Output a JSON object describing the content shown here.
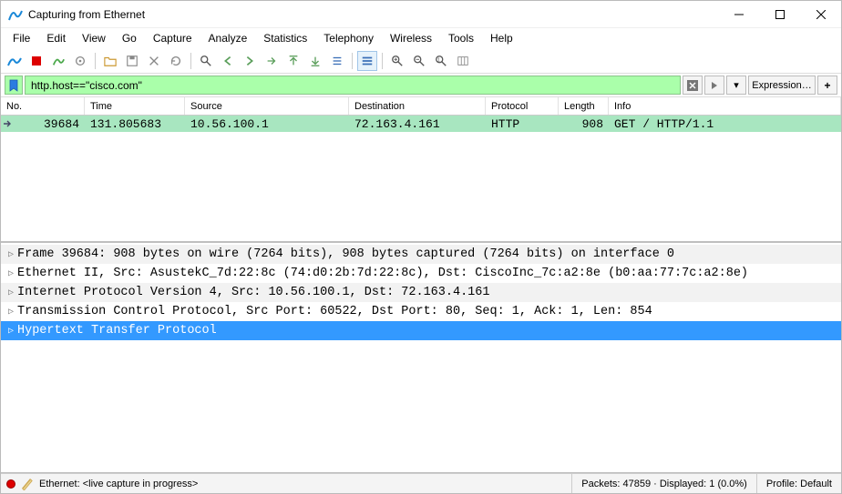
{
  "window": {
    "title": "Capturing from Ethernet"
  },
  "menu": {
    "items": [
      "File",
      "Edit",
      "View",
      "Go",
      "Capture",
      "Analyze",
      "Statistics",
      "Telephony",
      "Wireless",
      "Tools",
      "Help"
    ]
  },
  "filter": {
    "value": "http.host==\"cisco.com\"",
    "expression_label": "Expression…",
    "plus_label": "+"
  },
  "packet_list": {
    "columns": [
      "No.",
      "Time",
      "Source",
      "Destination",
      "Protocol",
      "Length",
      "Info"
    ],
    "rows": [
      {
        "no": "39684",
        "time": "131.805683",
        "source": "10.56.100.1",
        "destination": "72.163.4.161",
        "protocol": "HTTP",
        "length": "908",
        "info": "GET  /  HTTP/1.1"
      }
    ]
  },
  "packet_details": {
    "lines": [
      "Frame 39684: 908 bytes on wire (7264 bits), 908 bytes captured (7264 bits) on interface 0",
      "Ethernet II, Src: AsustekC_7d:22:8c (74:d0:2b:7d:22:8c), Dst: CiscoInc_7c:a2:8e (b0:aa:77:7c:a2:8e)",
      "Internet Protocol Version 4, Src: 10.56.100.1, Dst: 72.163.4.161",
      "Transmission Control Protocol, Src Port: 60522, Dst Port: 80, Seq: 1, Ack: 1, Len: 854",
      "Hypertext Transfer Protocol"
    ],
    "selected_index": 4
  },
  "status": {
    "interface": "Ethernet: <live capture in progress>",
    "packets": "Packets: 47859 · Displayed: 1 (0.0%)",
    "profile": "Profile: Default"
  }
}
